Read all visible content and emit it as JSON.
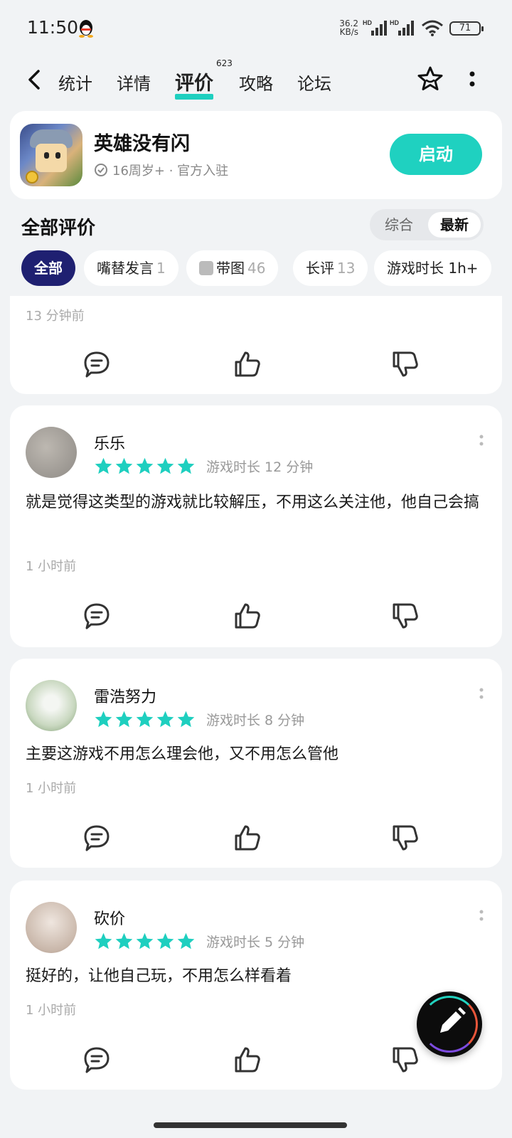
{
  "status": {
    "time": "11:50",
    "netspeed_top": "36.2",
    "netspeed_bottom": "KB/s",
    "sig1_label": "HD",
    "sig2_label": "HD",
    "battery": "71"
  },
  "nav": {
    "tabs": [
      "统计",
      "详情",
      "评价",
      "攻略",
      "论坛"
    ],
    "active_tab": "评价",
    "review_badge": "623"
  },
  "app": {
    "name": "英雄没有闪",
    "meta": "16周岁+ · 官方入驻",
    "launch_label": "启动"
  },
  "section": {
    "title": "全部评价",
    "sort_options": [
      "综合",
      "最新"
    ],
    "sort_selected": "最新"
  },
  "filters": [
    {
      "label": "全部",
      "count": ""
    },
    {
      "label": "嘴替发言",
      "count": "1"
    },
    {
      "label": "带图",
      "count": "46"
    },
    {
      "label": "长评",
      "count": "13"
    },
    {
      "label": "游戏时长 1h+",
      "count": ""
    }
  ],
  "partial_review": {
    "time_ago": "13 分钟前"
  },
  "reviews": [
    {
      "user": "乐乐",
      "rating": 5,
      "playtime": "游戏时长 12 分钟",
      "text": "就是觉得这类型的游戏就比较解压，不用这么关注他，他自己会搞",
      "time_ago": "1 小时前"
    },
    {
      "user": "雷浩努力",
      "rating": 5,
      "playtime": "游戏时长 8 分钟",
      "text": "主要这游戏不用怎么理会他，又不用怎么管他",
      "time_ago": "1 小时前"
    },
    {
      "user": "砍价",
      "rating": 5,
      "playtime": "游戏时长 5 分钟",
      "text": "挺好的，让他自己玩，不用怎么样看着",
      "time_ago": "1 小时前"
    }
  ],
  "colors": {
    "accent": "#1fd1c0",
    "chip_active": "#1f2071",
    "star": "#1ecfbf"
  },
  "icons": {
    "back": "back-arrow-icon",
    "favorite": "star-outline-icon",
    "more": "more-vertical-icon",
    "comment": "comment-icon",
    "like": "thumbs-up-icon",
    "dislike": "thumbs-down-icon",
    "compose": "pencil-icon"
  }
}
